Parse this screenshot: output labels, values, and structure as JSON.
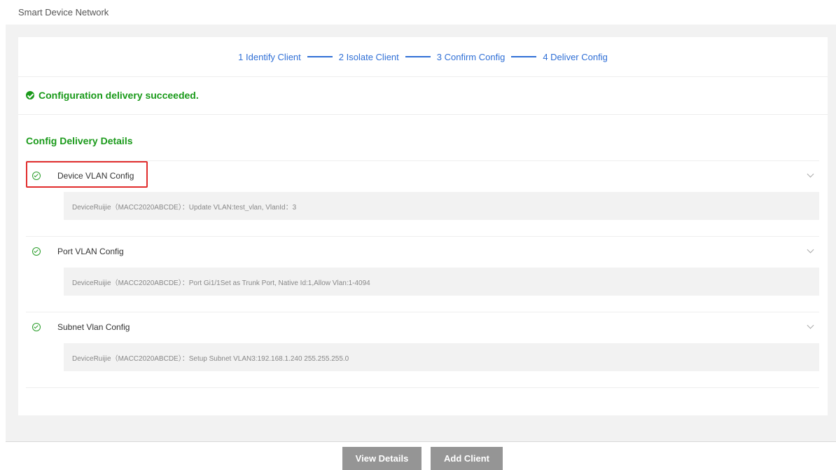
{
  "page_title": "Smart Device Network",
  "steps": [
    {
      "label": "1 Identify Client"
    },
    {
      "label": "2 Isolate Client"
    },
    {
      "label": "3 Confirm Config"
    },
    {
      "label": "4 Deliver Config"
    }
  ],
  "status": {
    "message": "Configuration delivery succeeded.",
    "icon": "success-check-icon",
    "color": "#1a9a1a"
  },
  "section_title": "Config Delivery Details",
  "items": [
    {
      "label": "Device VLAN Config",
      "detail": "DeviceRuijie（MACC2020ABCDE）：Update VLAN:test_vlan, VlanId：3"
    },
    {
      "label": "Port VLAN Config",
      "detail": "DeviceRuijie（MACC2020ABCDE）：Port Gi1/1Set as Trunk Port, Native Id:1,Allow Vlan:1-4094"
    },
    {
      "label": "Subnet Vlan Config",
      "detail": "DeviceRuijie（MACC2020ABCDE）：Setup Subnet VLAN3:192.168.1.240 255.255.255.0"
    }
  ],
  "buttons": {
    "view_details": "View Details",
    "add_client": "Add Client"
  },
  "colors": {
    "accent": "#2f6fd6",
    "success": "#1a9a1a",
    "highlight": "#e12c2c",
    "button": "#959595"
  }
}
